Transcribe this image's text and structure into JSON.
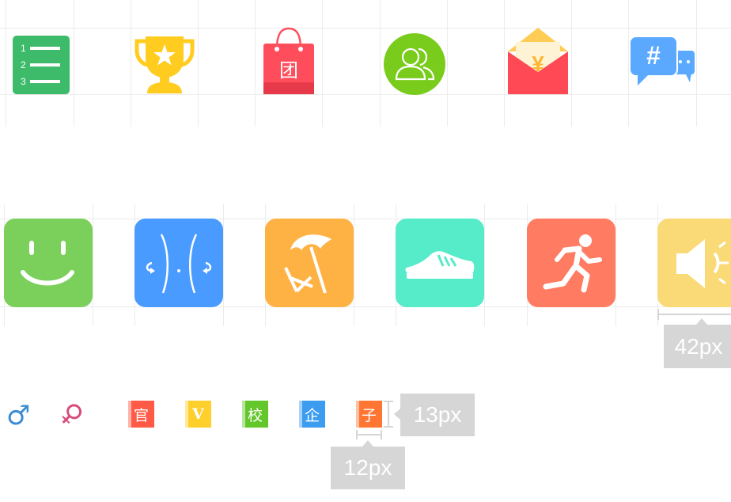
{
  "colors": {
    "list_green": "#3dbb6a",
    "trophy_yellow": "#ffcc1f",
    "bag_red": "#ff4d5c",
    "contacts_green": "#79cc1b",
    "envelope_red": "#ff4a55",
    "chat_blue": "#5aa9ff",
    "smile_green": "#7ad05a",
    "body_blue": "#4a9bff",
    "beach_orange": "#ffb244",
    "shoe_teal": "#56ebc9",
    "run_orange": "#ff7b62",
    "speaker_yellow": "#fada76",
    "male_blue": "#3a8cd4",
    "female_pink": "#d84c7c",
    "badge_official": "#ff5a45",
    "badge_v": "#ffcf2c",
    "badge_school": "#63c72c",
    "badge_enterprise": "#3c9cf0",
    "badge_child": "#ff7633",
    "measure_gray": "#d6d6d6"
  },
  "row1": {
    "list_icon": {
      "numbers": [
        "1",
        "2",
        "3"
      ]
    },
    "bag_icon": {
      "char": "团"
    },
    "envelope_icon": {
      "char": "¥"
    },
    "chat_icon": {
      "char": "#"
    }
  },
  "row2": {
    "measure_label": "42px"
  },
  "row3": {
    "gender_male": "♂",
    "gender_female": "♀",
    "badges": [
      {
        "char": "官"
      },
      {
        "char": "V"
      },
      {
        "char": "校"
      },
      {
        "char": "企"
      },
      {
        "char": "子"
      }
    ],
    "measure_height_label": "13px",
    "measure_width_label": "12px"
  }
}
